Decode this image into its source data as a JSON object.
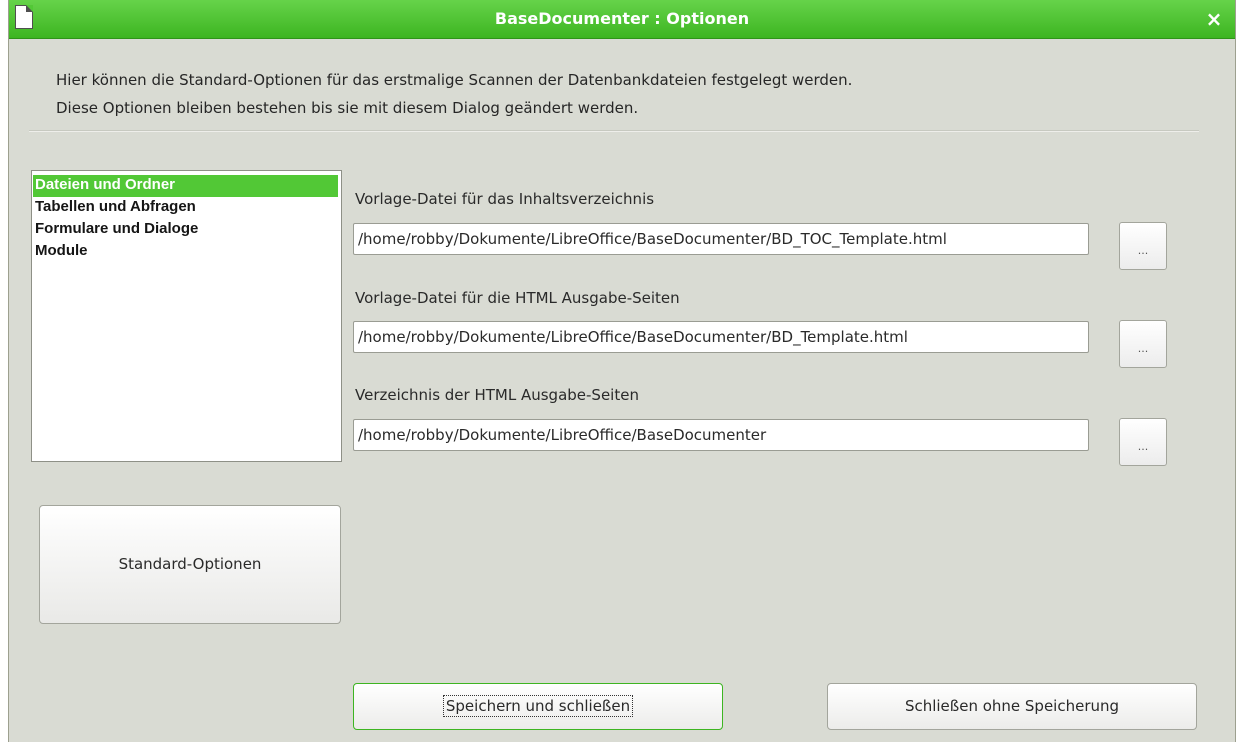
{
  "window": {
    "title": "BaseDocumenter : Optionen",
    "close_symbol": "×"
  },
  "intro": {
    "line1": "Hier können die Standard-Optionen für das erstmalige Scannen der Datenbankdateien festgelegt werden.",
    "line2": "Diese Optionen bleiben bestehen bis sie mit diesem Dialog geändert werden."
  },
  "categories": {
    "items": [
      {
        "label": "Dateien und Ordner",
        "selected": true
      },
      {
        "label": "Tabellen und Abfragen",
        "selected": false
      },
      {
        "label": "Formulare und Dialoge",
        "selected": false
      },
      {
        "label": "Module",
        "selected": false
      }
    ]
  },
  "fields": [
    {
      "label": "Vorlage-Datei für das Inhaltsverzeichnis",
      "value": "/home/robby/Dokumente/LibreOffice/BaseDocumenter/BD_TOC_Template.html",
      "browse_label": "..."
    },
    {
      "label": "Vorlage-Datei für die HTML Ausgabe-Seiten",
      "value": "/home/robby/Dokumente/LibreOffice/BaseDocumenter/BD_Template.html",
      "browse_label": "..."
    },
    {
      "label": "Verzeichnis der HTML Ausgabe-Seiten",
      "value": "/home/robby/Dokumente/LibreOffice/BaseDocumenter",
      "browse_label": "..."
    }
  ],
  "buttons": {
    "standard_options": "Standard-Optionen",
    "save_close": "Speichern und schließen",
    "close_without_save": "Schließen ohne Speicherung"
  },
  "icons": {
    "title_icon": "document-icon",
    "close_icon": "close-icon"
  },
  "colors": {
    "accent": "#52c836",
    "dialog_bg": "#d9dbd3"
  }
}
